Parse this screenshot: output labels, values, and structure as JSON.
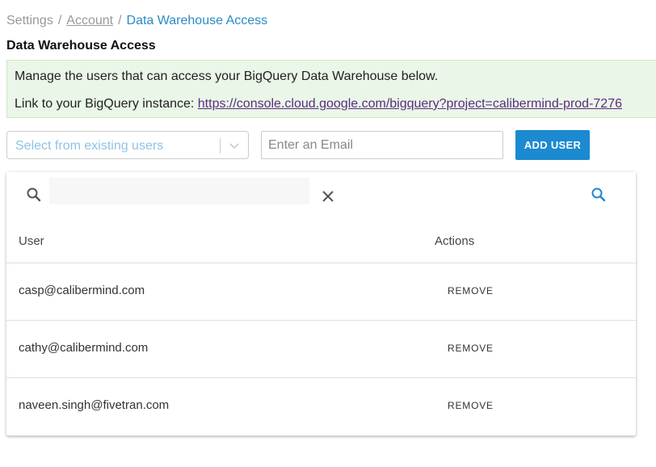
{
  "breadcrumb": {
    "root": "Settings",
    "separator": "/",
    "account": "Account",
    "current": "Data Warehouse Access"
  },
  "page": {
    "title": "Data Warehouse Access"
  },
  "info": {
    "line1": "Manage the users that can access your BigQuery Data Warehouse below.",
    "link_prefix": "Link to your BigQuery instance: ",
    "link_text": "https://console.cloud.google.com/bigquery?project=calibermind-prod-7276"
  },
  "controls": {
    "select_placeholder": "Select from existing users",
    "email_placeholder": "Enter an Email",
    "add_button": "ADD USER"
  },
  "table": {
    "search_value": "",
    "columns": {
      "user": "User",
      "actions": "Actions"
    },
    "rows": [
      {
        "user": "casp@calibermind.com",
        "action": "REMOVE"
      },
      {
        "user": "cathy@calibermind.com",
        "action": "REMOVE"
      },
      {
        "user": "naveen.singh@fivetran.com",
        "action": "REMOVE"
      }
    ]
  },
  "icons": {
    "search": "search-icon",
    "clear": "close-icon",
    "dropdown": "chevron-down-icon"
  },
  "colors": {
    "accent": "#1b8ad0",
    "info_bg": "#eaf6e7",
    "link": "#5a2d82",
    "breadcrumb_current": "#2b8ac6"
  }
}
